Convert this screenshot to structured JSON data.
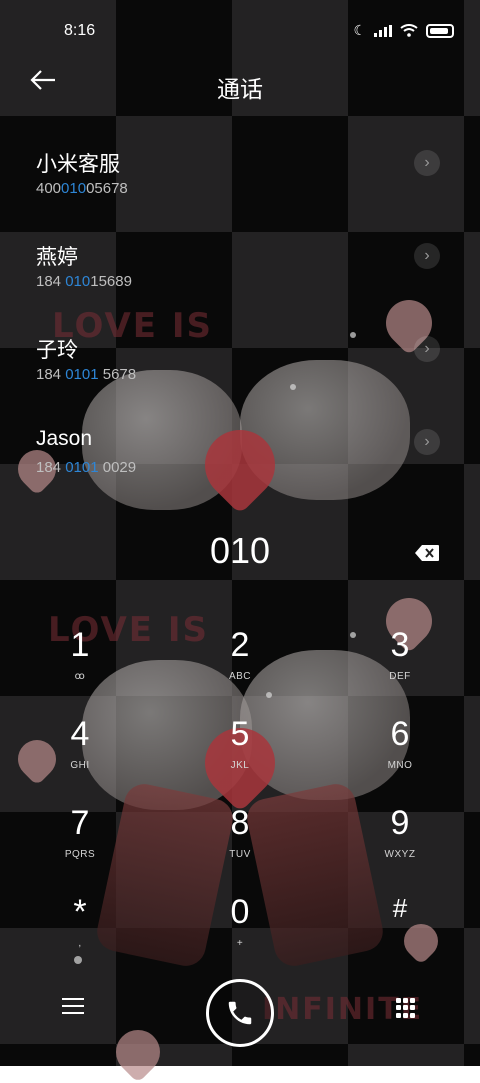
{
  "status": {
    "time": "8:16"
  },
  "header": {
    "title": "通话",
    "back_icon": "arrow-left-icon"
  },
  "results": [
    {
      "name": "小米客服",
      "num_pre": "400",
      "num_hl": "010",
      "num_post": "05678"
    },
    {
      "name": "燕婷",
      "num_pre": "184 ",
      "num_hl": "010",
      "num_post": "15689"
    },
    {
      "name": "子玲",
      "num_pre": "184 ",
      "num_hl": "0101",
      "num_post": " 5678"
    },
    {
      "name": "Jason",
      "num_pre": "184 ",
      "num_hl": "0101",
      "num_post": " 0029"
    }
  ],
  "dial": {
    "value": "010"
  },
  "keys": [
    {
      "digit": "1",
      "letters": "ꝏ"
    },
    {
      "digit": "2",
      "letters": "ABC"
    },
    {
      "digit": "3",
      "letters": "DEF"
    },
    {
      "digit": "4",
      "letters": "GHI"
    },
    {
      "digit": "5",
      "letters": "JKL"
    },
    {
      "digit": "6",
      "letters": "MNO"
    },
    {
      "digit": "7",
      "letters": "PQRS"
    },
    {
      "digit": "8",
      "letters": "TUV"
    },
    {
      "digit": "9",
      "letters": "WXYZ"
    },
    {
      "digit": "*",
      "letters": ","
    },
    {
      "digit": "0",
      "letters": "+"
    },
    {
      "digit": "#",
      "letters": ""
    }
  ],
  "wallpaper": {
    "text1": "LOVE IS",
    "text2": "LOVE IS",
    "text3": "INFINITE"
  },
  "colors": {
    "accent": "#2e86d6"
  }
}
